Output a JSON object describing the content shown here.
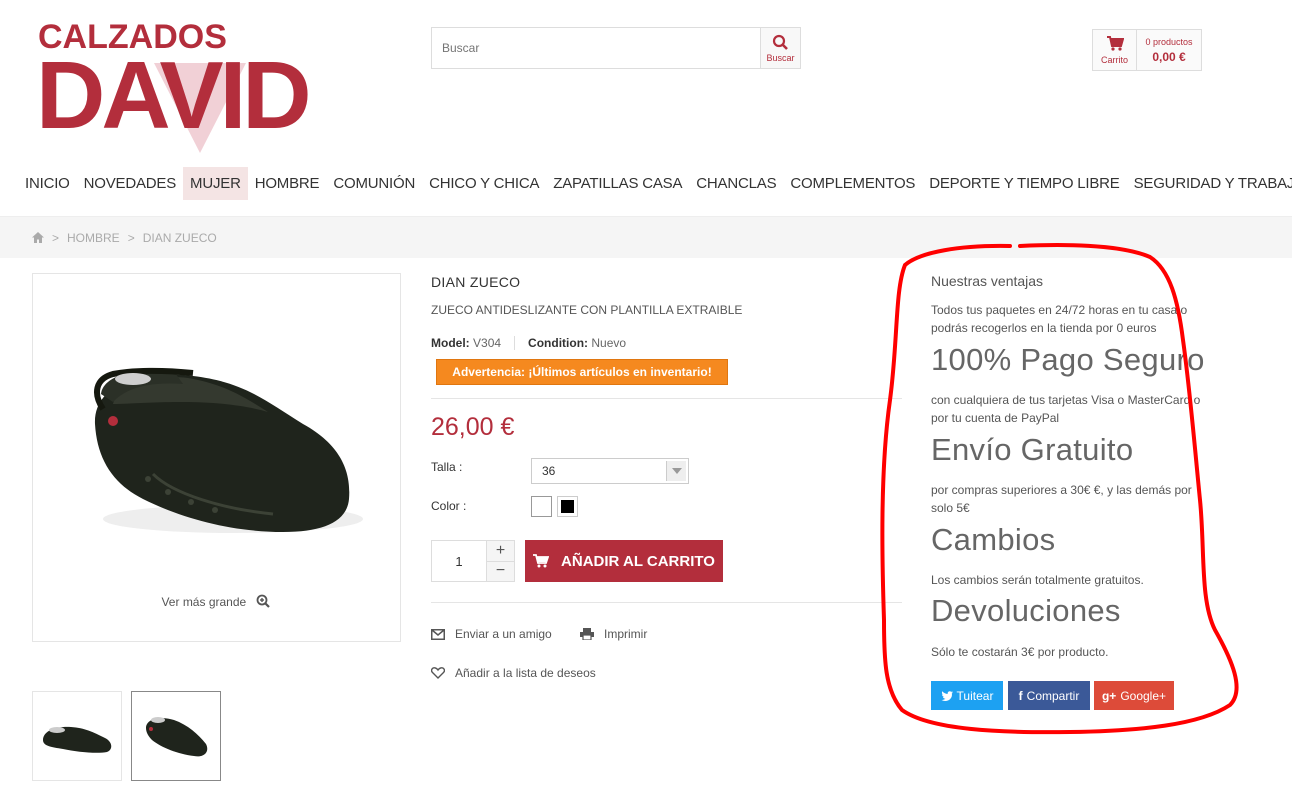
{
  "header": {
    "logo_top": "CALZADOS",
    "logo_main": "DAVID",
    "search_placeholder": "Buscar",
    "search_button": "Buscar",
    "cart_label": "Carrito",
    "cart_count": "0 productos",
    "cart_total": "0,00 €"
  },
  "nav": {
    "items": [
      "INICIO",
      "NOVEDADES",
      "MUJER",
      "HOMBRE",
      "COMUNIÓN",
      "CHICO Y CHICA",
      "ZAPATILLAS CASA",
      "CHANCLAS",
      "COMPLEMENTOS",
      "DEPORTE Y TIEMPO LIBRE",
      "SEGURIDAD Y TRABAJO"
    ],
    "active": "MUJER"
  },
  "breadcrumb": {
    "items": [
      "HOMBRE",
      "DIAN ZUECO"
    ]
  },
  "product": {
    "zoom_label": "Ver más grande",
    "title": "DIAN ZUECO",
    "subtitle": "ZUECO ANTIDESLIZANTE CON PLANTILLA EXTRAIBLE",
    "model_label": "Model:",
    "model_value": "V304",
    "condition_label": "Condition:",
    "condition_value": "Nuevo",
    "warning": "Advertencia: ¡Últimos artículos en inventario!",
    "price": "26,00 €",
    "size_label": "Talla :",
    "size_value": "36",
    "color_label": "Color :",
    "colors": [
      "#ffffff",
      "#000000"
    ],
    "quantity": "1",
    "qty_plus": "+",
    "qty_minus": "−",
    "add_to_cart": "AÑADIR AL CARRITO",
    "send_friend": "Enviar a un amigo",
    "print": "Imprimir",
    "wishlist": "Añadir a la lista de deseos"
  },
  "sidebar": {
    "title": "Nuestras ventajas",
    "intro": "Todos tus paquetes en 24/72 horas en tu casa o podrás recogerlos en la tienda por 0 euros",
    "h1": "100% Pago Seguro",
    "p1": "con cualquiera de tus tarjetas Visa o MasterCard o por tu cuenta de PayPal",
    "h2": "Envío Gratuito",
    "p2": "por compras superiores a 30€ €, y las demás por solo 5€",
    "h3": "Cambios",
    "p3": "Los cambios serán totalmente gratuitos.",
    "h4": "Devoluciones",
    "p4": "Sólo te costarán 3€ por producto.",
    "share_twitter": "Tuitear",
    "share_facebook": "Compartir",
    "share_google": "Google+"
  },
  "colors": {
    "brand": "#b32e3c",
    "warning": "#f5891f",
    "twitter": "#1da1f2",
    "facebook": "#3b5998",
    "google": "#dd4b39",
    "annotation": "#ff0000"
  }
}
